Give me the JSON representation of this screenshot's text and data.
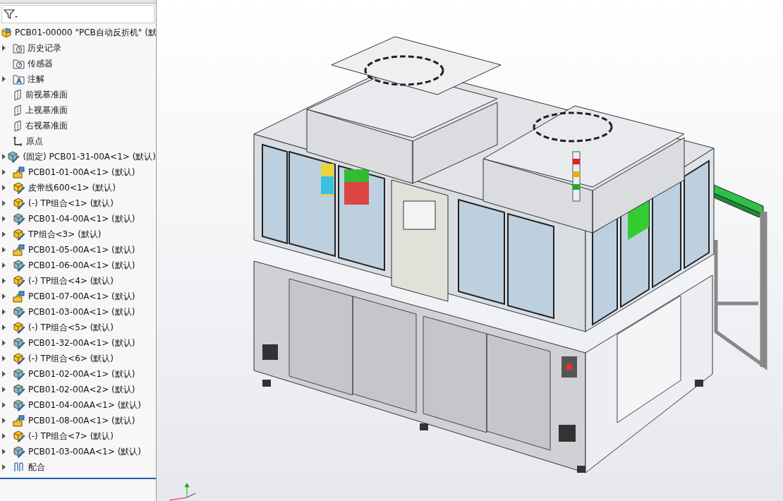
{
  "tree": {
    "root": {
      "label": "PCB01-00000 \"PCB自动反折机\" (默"
    },
    "items": [
      {
        "kind": "history",
        "label": "历史记录",
        "expandable": true
      },
      {
        "kind": "sensor",
        "label": "传感器",
        "expandable": false
      },
      {
        "kind": "annotation",
        "label": "注解",
        "expandable": true
      },
      {
        "kind": "plane",
        "label": "前视基准面",
        "expandable": false
      },
      {
        "kind": "plane",
        "label": "上视基准面",
        "expandable": false
      },
      {
        "kind": "plane",
        "label": "右视基准面",
        "expandable": false
      },
      {
        "kind": "origin",
        "label": "原点",
        "expandable": false
      },
      {
        "kind": "assembly",
        "label": "(固定) PCB01-31-00A<1> (默认)",
        "expandable": true
      },
      {
        "kind": "part",
        "label": "PCB01-01-00A<1> (默认)",
        "expandable": true
      },
      {
        "kind": "assembly-yellow",
        "label": "皮带线600<1> (默认)",
        "expandable": true
      },
      {
        "kind": "assembly-yellow",
        "label": "(-) TP组合<1> (默认)",
        "expandable": true
      },
      {
        "kind": "assembly",
        "label": "PCB01-04-00A<1> (默认)",
        "expandable": true
      },
      {
        "kind": "assembly-yellow",
        "label": "TP组合<3> (默认)",
        "expandable": true
      },
      {
        "kind": "part",
        "label": "PCB01-05-00A<1> (默认)",
        "expandable": true
      },
      {
        "kind": "assembly",
        "label": "PCB01-06-00A<1> (默认)",
        "expandable": true
      },
      {
        "kind": "assembly-yellow",
        "label": "(-) TP组合<4> (默认)",
        "expandable": true
      },
      {
        "kind": "part",
        "label": "PCB01-07-00A<1> (默认)",
        "expandable": true
      },
      {
        "kind": "assembly",
        "label": "PCB01-03-00A<1> (默认)",
        "expandable": true
      },
      {
        "kind": "assembly-yellow",
        "label": "(-) TP组合<5> (默认)",
        "expandable": true
      },
      {
        "kind": "assembly",
        "label": "PCB01-32-00A<1> (默认)",
        "expandable": true
      },
      {
        "kind": "assembly-yellow",
        "label": "(-) TP组合<6> (默认)",
        "expandable": true
      },
      {
        "kind": "assembly",
        "label": "PCB01-02-00A<1> (默认)",
        "expandable": true
      },
      {
        "kind": "assembly",
        "label": "PCB01-02-00A<2> (默认)",
        "expandable": true
      },
      {
        "kind": "assembly",
        "label": "PCB01-04-00AA<1> (默认)",
        "expandable": true
      },
      {
        "kind": "part",
        "label": "PCB01-08-00A<1> (默认)",
        "expandable": true
      },
      {
        "kind": "assembly-yellow",
        "label": "(-) TP组合<7> (默认)",
        "expandable": true
      },
      {
        "kind": "assembly",
        "label": "PCB01-03-00AA<1> (默认)",
        "expandable": true
      },
      {
        "kind": "mates",
        "label": "配合",
        "expandable": true
      }
    ]
  }
}
